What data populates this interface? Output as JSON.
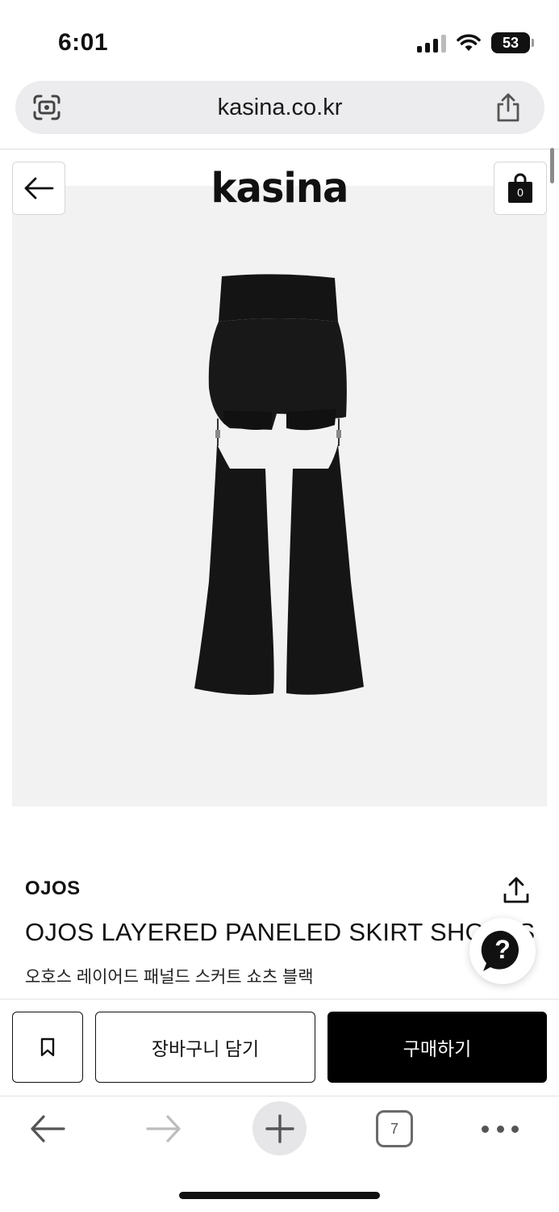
{
  "status_bar": {
    "time": "6:01",
    "battery": "53"
  },
  "browser": {
    "url": "kasina.co.kr",
    "tab_count": "7"
  },
  "site": {
    "logo": "kasina",
    "cart_count": "0"
  },
  "product": {
    "brand": "OJOS",
    "name": "OJOS LAYERED PANELED SKIRT SHORTS",
    "name_ko": "오호스 레이어드 패널드 스커트 쇼츠 블랙",
    "image_description_colors": {
      "background": "#f2f2f3",
      "garment": "#161616"
    }
  },
  "actions": {
    "add_to_cart": "장바구니 담기",
    "buy_now": "구매하기"
  },
  "help_button": {
    "label": "?"
  },
  "icons": {
    "url_left": "visual-search-icon",
    "url_right": "share-icon",
    "back": "arrow-left-icon",
    "cart": "shopping-bag-icon",
    "share": "share-upload-icon",
    "bookmark": "bookmark-icon",
    "help": "question-chat-icon",
    "toolbar": [
      "back-arrow-icon",
      "forward-arrow-icon",
      "plus-icon",
      "tabs-icon",
      "more-dots-icon"
    ]
  }
}
